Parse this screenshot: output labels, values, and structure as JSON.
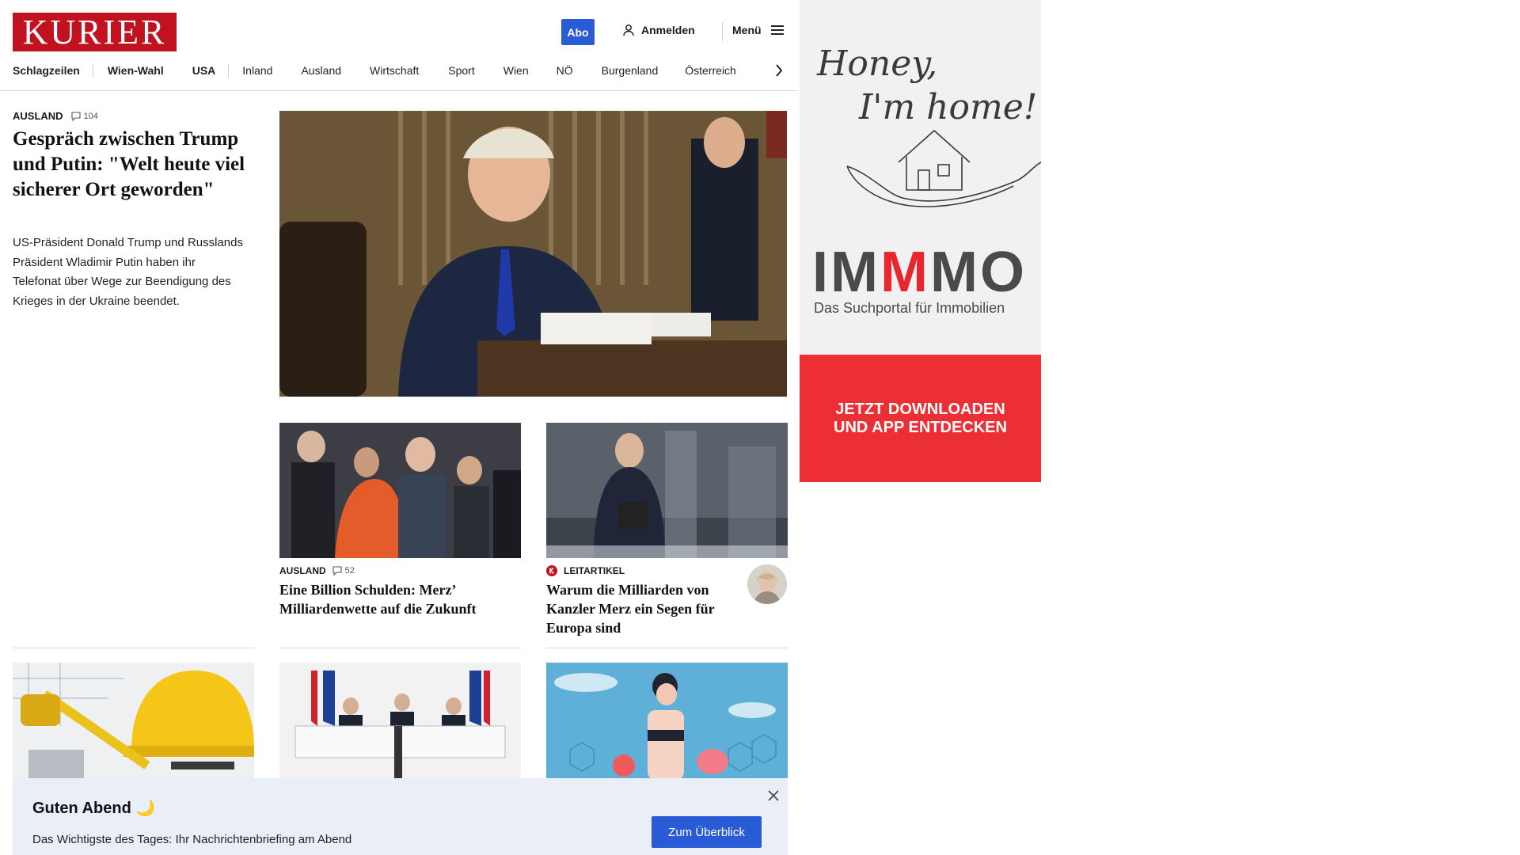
{
  "header": {
    "logo": "KURIER",
    "abo_label": "Abo",
    "login_label": "Anmelden",
    "menu_label": "Menü"
  },
  "nav": {
    "items": [
      "Schlagzeilen",
      "Wien-Wahl",
      "USA",
      "Inland",
      "Ausland",
      "Wirtschaft",
      "Sport",
      "Wien",
      "NÖ",
      "Burgenland",
      "Österreich"
    ]
  },
  "lead": {
    "category": "AUSLAND",
    "comments": "104",
    "title": "Gespräch zwischen Trump und Putin: \"Welt heute viel sicherer Ort geworden\"",
    "teaser": "US-Präsident Donald Trump und Russlands Präsident Wladimir Putin haben ihr Telefonat über Wege zur Beendigung des Krieges in der Ukraine beendet."
  },
  "cards": [
    {
      "category": "AUSLAND",
      "comments": "52",
      "title": "Eine Billion Schulden: Merz’ Milliardenwette auf die Zukunft"
    },
    {
      "category": "LEITARTIKEL",
      "title": "Warum die Milliarden von Kanzler Merz ein Segen für Europa sind"
    }
  ],
  "ad": {
    "tagline_line1": "Honey,",
    "tagline_line2": "I'm home!",
    "brand_pre": "IM",
    "brand_accent": "M",
    "brand_post": "MO",
    "subtitle": "Das Suchportal für Immobilien",
    "cta_line1": "JETZT DOWNLOADEN",
    "cta_line2": "UND APP ENTDECKEN",
    "accent_color": "#e8262e"
  },
  "briefing": {
    "title": "Guten Abend 🌙",
    "text": "Das Wichtigste des Tages: Ihr Nachrichtenbriefing am Abend",
    "button": "Zum Überblick"
  },
  "colors": {
    "brand_red": "#c1121f",
    "primary_blue": "#2a5bd7",
    "briefing_bg": "#e9eef7"
  }
}
